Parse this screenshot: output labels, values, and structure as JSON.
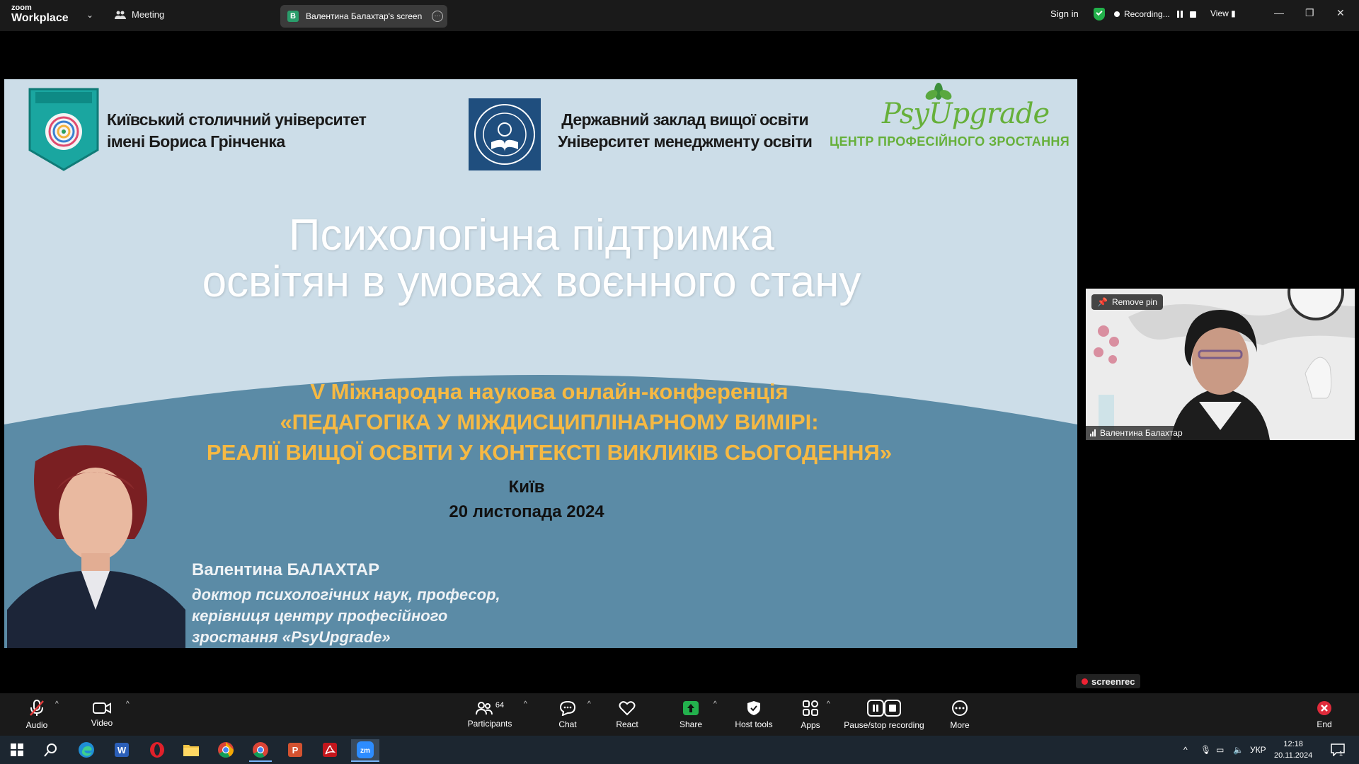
{
  "app": {
    "logo_top": "zoom",
    "logo_bottom": "Workplace",
    "meeting_label": "Meeting",
    "screen_tab": {
      "avatar": "B",
      "label": "Валентина Балахтар's screen"
    },
    "sign_in": "Sign in",
    "recording_label": "Recording...",
    "view_label": "View"
  },
  "slide": {
    "uni1_line1": "Київський столичний університет",
    "uni1_line2": "імені Бориса Грінченка",
    "uni2_line1": "Державний заклад вищої освіти",
    "uni2_line2": "Університет менеджменту освіти",
    "psy_name": "PsyUpgrade",
    "psy_sub": "ЦЕНТР ПРОФЕСІЙНОГО ЗРОСТАННЯ",
    "title_line1": "Психологічна підтримка",
    "title_line2": "освітян в умовах воєнного стану",
    "conf_line1": "V Міжнародна наукова онлайн-конференція",
    "conf_line2": "«ПЕДАГОГІКА У МІЖДИСЦИПЛІНАРНОМУ ВИМІРІ:",
    "conf_line3": "РЕАЛІЇ ВИЩОЇ ОСВІТИ У КОНТЕКСТІ ВИКЛИКІВ СЬОГОДЕННЯ»",
    "city": "Київ",
    "date": "20 листопада 2024",
    "author": "Валентина БАЛАХТАР",
    "author_desc1": "доктор психологічних наук, професор,",
    "author_desc2": "керівниця центру професійного",
    "author_desc3": "зростання «PsyUpgrade»"
  },
  "video": {
    "remove_pin": "Remove pin",
    "name": "Валентина Балахтар"
  },
  "watermark": "screenrec",
  "toolbar": {
    "audio": "Audio",
    "video": "Video",
    "participants": "Participants",
    "participants_count": "64",
    "chat": "Chat",
    "react": "React",
    "share": "Share",
    "host_tools": "Host tools",
    "apps": "Apps",
    "pause_stop": "Pause/stop recording",
    "more": "More",
    "end": "End"
  },
  "taskbar": {
    "lang": "УКР",
    "time": "12:18",
    "date": "20.11.2024",
    "notif_count": "1"
  },
  "colors": {
    "slide_bg": "#ccdde8",
    "wave": "#5b8ba6",
    "accent_orange": "#f6b943",
    "psy_green": "#66b03a",
    "share_green": "#23b14d"
  }
}
